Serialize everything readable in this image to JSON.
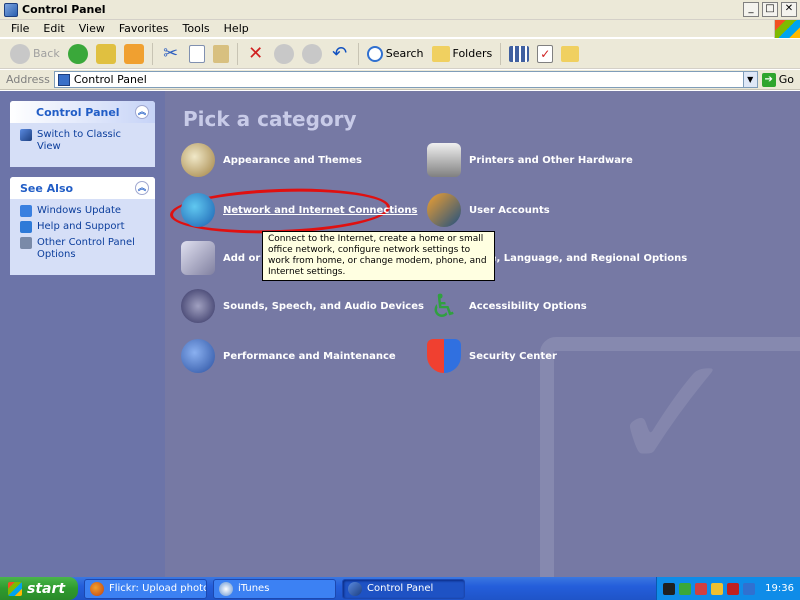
{
  "window": {
    "title": "Control Panel",
    "buttons": {
      "minimize": "_",
      "maximize": "□",
      "close": "✕"
    }
  },
  "menu": {
    "items": [
      "File",
      "Edit",
      "View",
      "Favorites",
      "Tools",
      "Help"
    ]
  },
  "toolbar": {
    "back_label": "Back",
    "search_label": "Search",
    "folders_label": "Folders",
    "cut_glyph": "✂",
    "delete_glyph": "✕",
    "undo_glyph": "↶",
    "properties_glyph": "✓"
  },
  "address": {
    "label": "Address",
    "value": "Control Panel",
    "dropdown_glyph": "▼",
    "go_glyph": "➔",
    "go_label": "Go"
  },
  "sidebar": {
    "control_panel": {
      "title": "Control Panel",
      "collapse_glyph": "︽",
      "links": [
        {
          "label": "Switch to Classic View",
          "icon": "classic-view-icon"
        }
      ]
    },
    "see_also": {
      "title": "See Also",
      "collapse_glyph": "︽",
      "links": [
        {
          "label": "Windows Update",
          "icon": "windows-update-icon"
        },
        {
          "label": "Help and Support",
          "icon": "help-support-icon"
        },
        {
          "label": "Other Control Panel Options",
          "icon": "other-options-icon"
        }
      ]
    }
  },
  "main": {
    "title": "Pick a category",
    "categories": [
      {
        "label": "Appearance and Themes",
        "icon": "appearance-icon"
      },
      {
        "label": "Network and Internet Connections",
        "icon": "network-icon"
      },
      {
        "label": "Add or Re",
        "icon": "add-remove-icon"
      },
      {
        "label": "Sounds, Speech, and Audio Devices",
        "icon": "sounds-icon"
      },
      {
        "label": "Performance and Maintenance",
        "icon": "performance-icon"
      },
      {
        "label": "Printers and Other Hardware",
        "icon": "printers-icon"
      },
      {
        "label": "User Accounts",
        "icon": "users-icon"
      },
      {
        "label": "Time, Language, and Regional Options",
        "icon": "datetime-icon"
      },
      {
        "label": "Accessibility Options",
        "icon": "accessibility-icon",
        "glyph": "♿"
      },
      {
        "label": "Security Center",
        "icon": "security-icon"
      }
    ],
    "tooltip": "Connect to the Internet, create a home or small office network, configure network settings to work from home, or change modem, phone, and Internet settings."
  },
  "taskbar": {
    "start_label": "start",
    "tasks": [
      {
        "label": "Flickr: Upload photos ...",
        "icon": "firefox-icon"
      },
      {
        "label": "iTunes",
        "icon": "itunes-icon"
      },
      {
        "label": "Control Panel",
        "icon": "control-panel-icon",
        "active": true
      }
    ],
    "clock": "19:36"
  },
  "colors": {
    "sidebar_bg": "#6c74a8",
    "main_bg": "#7679a4",
    "taskbar": "#245edb",
    "start": "#2e9a2e",
    "highlight_oval": "#e01010"
  }
}
